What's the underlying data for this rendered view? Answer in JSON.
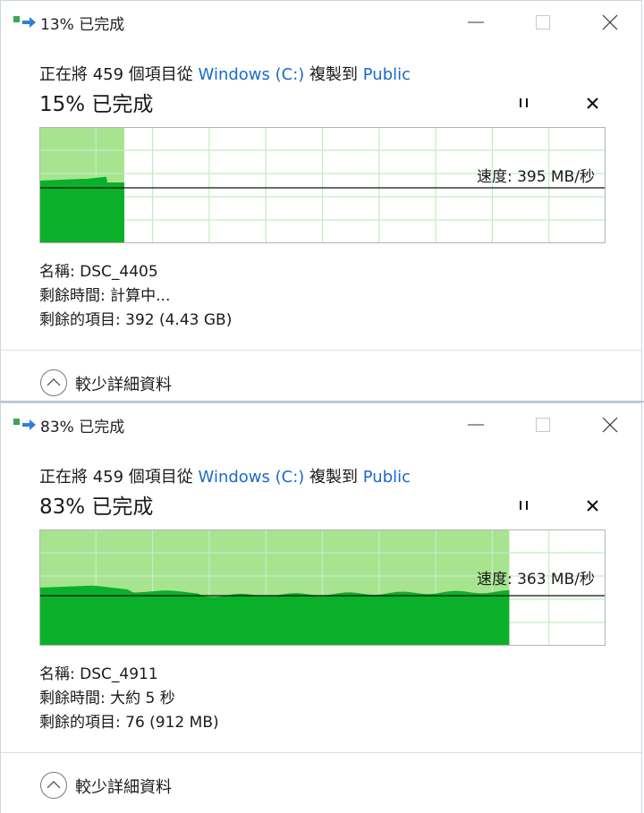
{
  "dialogs": [
    {
      "window_title": "13% 已完成",
      "prefix": "正在將 459 個項目從",
      "source": "Windows (C:)",
      "mid": "複製到",
      "dest": "Public",
      "percent_label": "15% 已完成",
      "progress_fraction": 0.15,
      "speed_label": "速度: 395 MB/秒",
      "name_line": "名稱: DSC_4405",
      "time_line": "剩餘時間: 計算中...",
      "items_line": "剩餘的項目: 392 (4.43 GB)",
      "more_label": "較少詳細資料"
    },
    {
      "window_title": "83% 已完成",
      "prefix": "正在將 459 個項目從",
      "source": "Windows (C:)",
      "mid": "複製到",
      "dest": "Public",
      "percent_label": "83% 已完成",
      "progress_fraction": 0.83,
      "speed_label": "速度: 363 MB/秒",
      "name_line": "名稱: DSC_4911",
      "time_line": "剩餘時間: 大約 5 秒",
      "items_line": "剩餘的項目: 76 (912 MB)",
      "more_label": "較少詳細資料"
    }
  ],
  "icons": {
    "minimize": "minimize-icon",
    "maximize": "maximize-icon",
    "close": "close-icon",
    "pause": "pause-icon",
    "cancel": "cancel-icon",
    "collapse": "chevron-up-icon",
    "app": "copy-progress-icon"
  },
  "colors": {
    "fill_light": "#a8e490",
    "fill_dark": "#0ab02a",
    "grid": "#c5ecc5",
    "link": "#1b6ac9"
  }
}
